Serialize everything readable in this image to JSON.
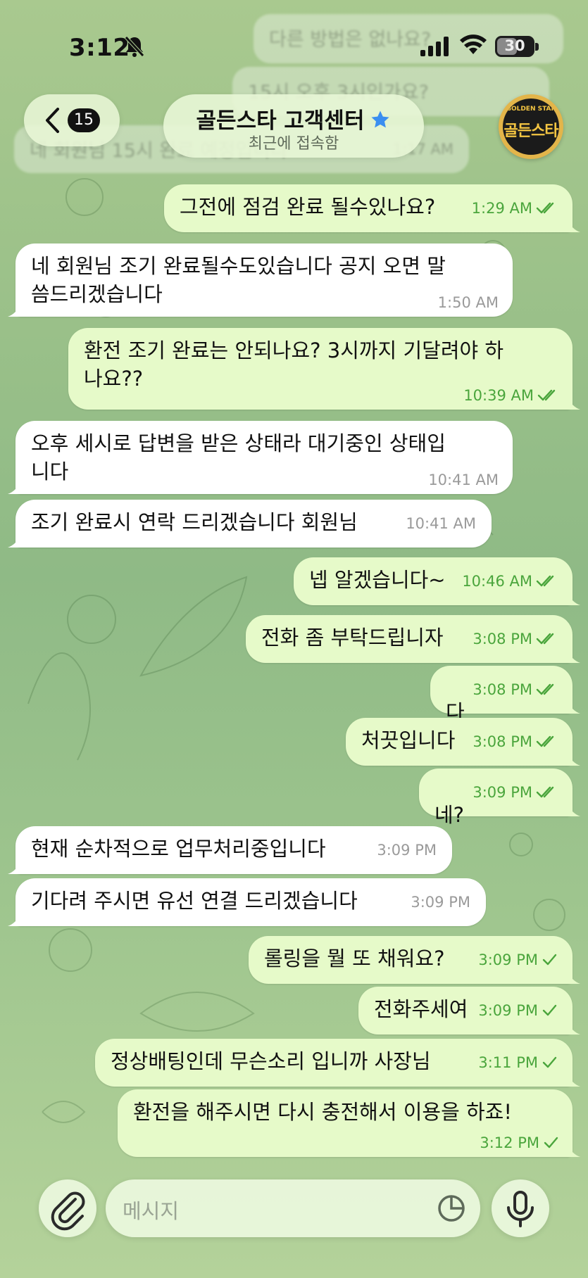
{
  "status_bar": {
    "time": "3:12",
    "battery": "30"
  },
  "header": {
    "back_count": "15",
    "title": "골든스타 고객센터",
    "subtitle": "최근에 접속함",
    "avatar_text": "골든스타",
    "avatar_top_text": "GOLDEN STAR"
  },
  "faded_messages": [
    {
      "text": "다른 방법은 없나요?"
    },
    {
      "text": "15시 오후 3시인가요?"
    },
    {
      "text": "네 회원님 15시 완료 예정입니다",
      "time": "1:17 AM"
    }
  ],
  "messages": [
    {
      "dir": "out",
      "text": "그전에 점검 완료 될수있나요?",
      "time": "1:29 AM",
      "read": true
    },
    {
      "dir": "in",
      "text": "네 회원님 조기 완료될수도있습니다 공지 오면 말\n씀드리겠습니다",
      "time": "1:50 AM"
    },
    {
      "dir": "out",
      "text": "환전 조기 완료는 안되나요? 3시까지 기달려야 하\n나요??",
      "time": "10:39 AM",
      "read": true
    },
    {
      "dir": "in",
      "text": "오후 세시로 답변을 받은 상태라 대기중인 상태입\n니다",
      "time": "10:41 AM"
    },
    {
      "dir": "in",
      "text": "조기 완료시 연락 드리겠습니다 회원님",
      "time": "10:41 AM"
    },
    {
      "dir": "out",
      "text": "넵 알겠습니다~",
      "time": "10:46 AM",
      "read": true
    },
    {
      "dir": "out",
      "text": "전화 좀 부탁드립니자",
      "time": "3:08 PM",
      "read": true
    },
    {
      "dir": "out",
      "text": "다",
      "time": "3:08 PM",
      "read": true
    },
    {
      "dir": "out",
      "text": "처끗입니다",
      "time": "3:08 PM",
      "read": true
    },
    {
      "dir": "out",
      "text": "네?",
      "time": "3:09 PM",
      "read": true
    },
    {
      "dir": "in",
      "text": "현재 순차적으로 업무처리중입니다",
      "time": "3:09 PM"
    },
    {
      "dir": "in",
      "text": "기다려 주시면 유선 연결 드리겠습니다",
      "time": "3:09 PM"
    },
    {
      "dir": "out",
      "text": "롤링을 뭘 또 채워요?",
      "time": "3:09 PM",
      "read": false
    },
    {
      "dir": "out",
      "text": "전화주세여",
      "time": "3:09 PM",
      "read": false
    },
    {
      "dir": "out",
      "text": "정상배팅인데 무슨소리 입니까 사장님",
      "time": "3:11 PM",
      "read": false
    },
    {
      "dir": "out",
      "text": "환전을 해주시면 다시 충전해서 이용을 하죠!",
      "time": "3:12 PM",
      "read": false
    }
  ],
  "composer": {
    "placeholder": "메시지"
  },
  "colors": {
    "outgoing_bubble": "#e6fac9",
    "incoming_bubble": "#ffffff",
    "check": "#4aa53c",
    "star": "#3a8ef0"
  }
}
